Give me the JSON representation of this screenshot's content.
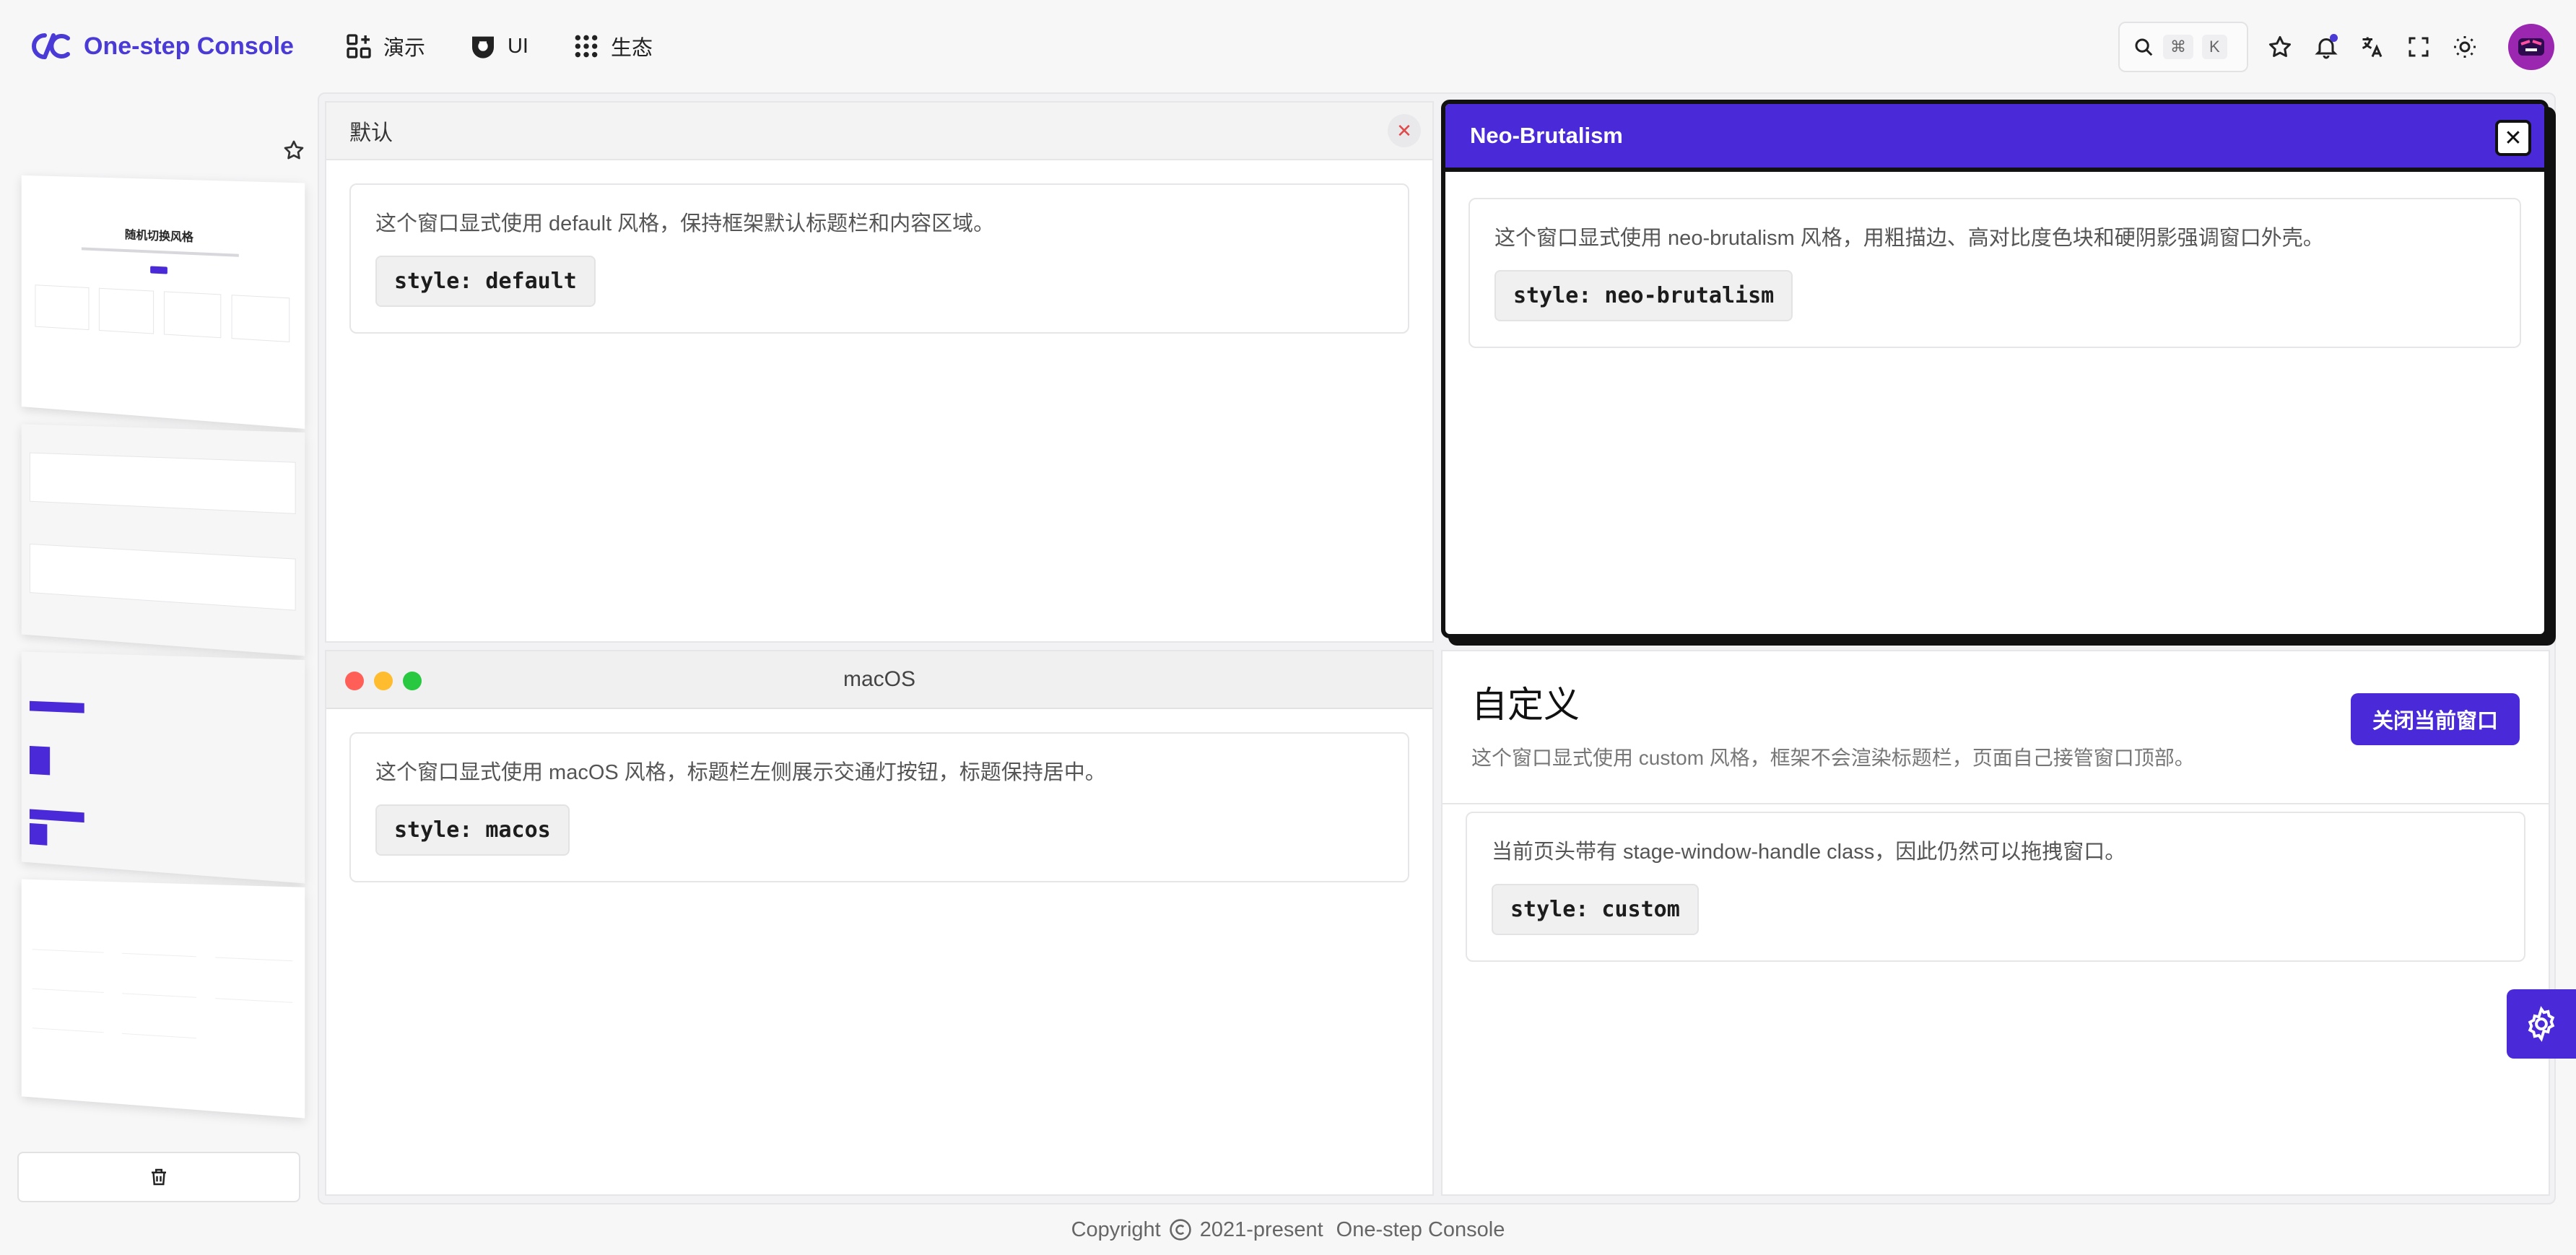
{
  "brand": {
    "name": "One-step Console"
  },
  "nav": [
    {
      "label": "演示",
      "icon": "dashboard-grid-icon"
    },
    {
      "label": "UI",
      "icon": "ui-icon"
    },
    {
      "label": "生态",
      "icon": "apps-grid-icon"
    }
  ],
  "search": {
    "key_cmd": "⌘",
    "key_k": "K"
  },
  "header_icons": [
    "star-icon",
    "bell-icon",
    "translate-icon",
    "fullscreen-icon",
    "sun-icon"
  ],
  "windows": {
    "default": {
      "title": "默认",
      "text": "这个窗口显式使用 default 风格，保持框架默认标题栏和内容区域。",
      "code": "style: default"
    },
    "neo": {
      "title": "Neo-Brutalism",
      "text": "这个窗口显式使用 neo-brutalism 风格，用粗描边、高对比度色块和硬阴影强调窗口外壳。",
      "code": "style: neo-brutalism"
    },
    "macos": {
      "title": "macOS",
      "text": "这个窗口显式使用 macOS 风格，标题栏左侧展示交通灯按钮，标题保持居中。",
      "code": "style: macos"
    },
    "custom": {
      "title": "自定义",
      "subtitle": "这个窗口显式使用 custom 风格，框架不会渲染标题栏，页面自己接管窗口顶部。",
      "button": "关闭当前窗口",
      "text": "当前页头带有 stage-window-handle class，因此仍然可以拖拽窗口。",
      "code": "style: custom"
    }
  },
  "thumb_main_title": "随机切换风格",
  "footer": {
    "copyright": "Copyright",
    "years": "2021-present",
    "owner": "One-step Console"
  },
  "colors": {
    "accent": "#4a2ad8",
    "brand": "#4a3ad6",
    "close_red": "#e04a4a"
  }
}
